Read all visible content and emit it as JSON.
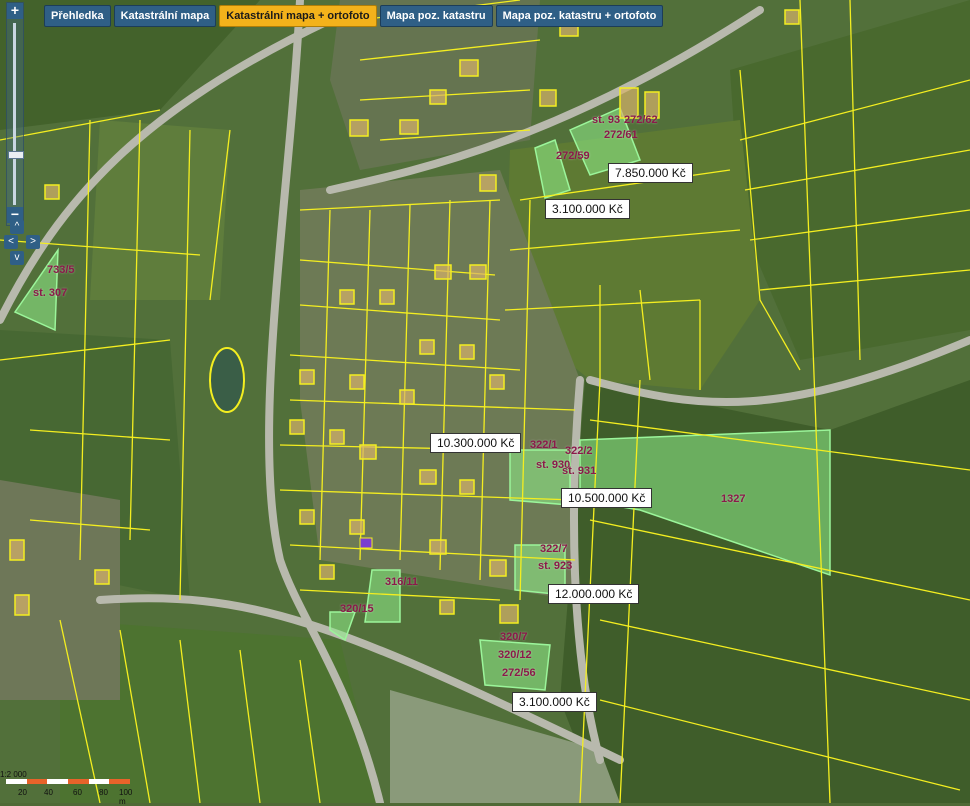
{
  "tabs": [
    {
      "label": "Přehledka",
      "active": false
    },
    {
      "label": "Katastrální mapa",
      "active": false
    },
    {
      "label": "Katastrální mapa + ortofoto",
      "active": true
    },
    {
      "label": "Mapa poz. katastru",
      "active": false
    },
    {
      "label": "Mapa poz. katastru + ortofoto",
      "active": false
    }
  ],
  "zoom": {
    "in_symbol": "+",
    "out_symbol": "−",
    "level": 0.7
  },
  "prices": [
    {
      "text": "7.850.000 Kč"
    },
    {
      "text": "3.100.000 Kč"
    },
    {
      "text": "10.300.000 Kč"
    },
    {
      "text": "10.500.000 Kč"
    },
    {
      "text": "12.000.000 Kč"
    },
    {
      "text": "3.100.000 Kč"
    }
  ],
  "parcels": [
    "st. 93",
    "272/62",
    "272/61",
    "272/59",
    "733/5",
    "st. 307",
    "322/1",
    "322/2",
    "st. 930",
    "st. 931",
    "1327",
    "322/7",
    "st. 923",
    "316/11",
    "320/15",
    "320/7",
    "320/12",
    "272/56"
  ],
  "scale": {
    "ratio": "1:2 000",
    "ticks": [
      "20",
      "40",
      "60",
      "80",
      "100 m"
    ]
  },
  "colors": {
    "boundary": "#f4ee20",
    "highlight": "#8ff08a",
    "label": "#8b1a4a",
    "tab": "#2f5f86",
    "tab_active": "#f3b21b"
  }
}
